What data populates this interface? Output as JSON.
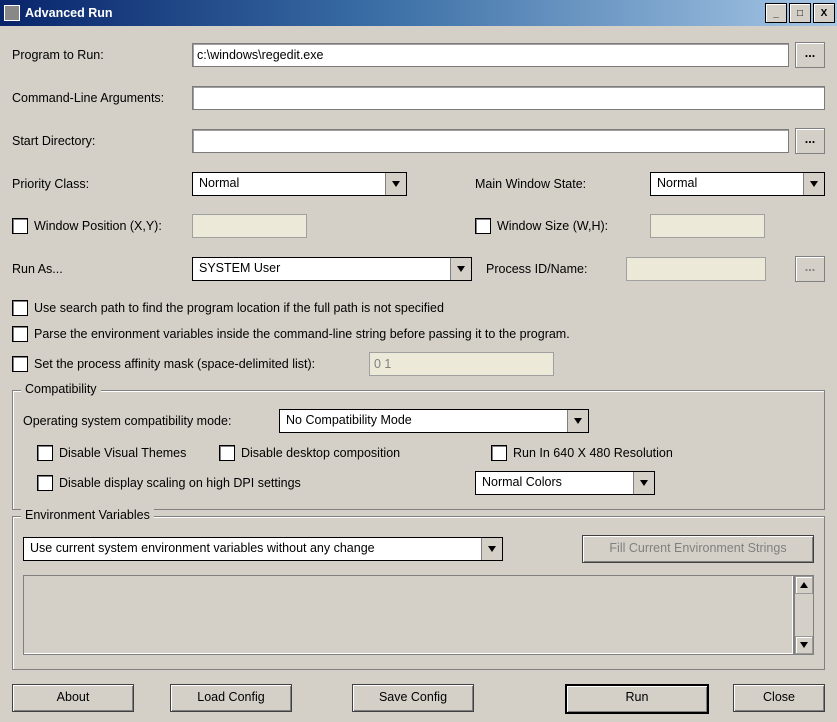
{
  "title": "Advanced Run",
  "labels": {
    "program": "Program to Run:",
    "cmdline": "Command-Line Arguments:",
    "startdir": "Start Directory:",
    "priority": "Priority Class:",
    "mainwin": "Main Window State:",
    "winpos": "Window Position (X,Y):",
    "winsize": "Window Size (W,H):",
    "runas": "Run As...",
    "pid": "Process ID/Name:",
    "searchpath": "Use search path to find the program location if the full path is not specified",
    "parseenv": "Parse the environment variables inside the command-line string before passing it to the program.",
    "affinity": "Set the process affinity mask (space-delimited list):"
  },
  "values": {
    "program": "c:\\windows\\regedit.exe",
    "cmdline": "",
    "startdir": "",
    "priority": "Normal",
    "mainwin": "Normal",
    "winpos": "",
    "winsize": "",
    "runas": "SYSTEM User",
    "pid": "",
    "affinity": "0 1"
  },
  "compat": {
    "legend": "Compatibility",
    "osmode_label": "Operating system compatibility mode:",
    "osmode_value": "No Compatibility Mode",
    "disable_themes": "Disable Visual Themes",
    "disable_comp": "Disable desktop composition",
    "run_640": "Run In 640 X 480 Resolution",
    "disable_dpi": "Disable display scaling on high DPI settings",
    "colors": "Normal Colors"
  },
  "env": {
    "legend": "Environment Variables",
    "mode": "Use current system environment variables without any change",
    "fill_btn": "Fill Current Environment Strings"
  },
  "buttons": {
    "about": "About",
    "load": "Load Config",
    "save": "Save Config",
    "run": "Run",
    "close": "Close",
    "browse": "..."
  }
}
